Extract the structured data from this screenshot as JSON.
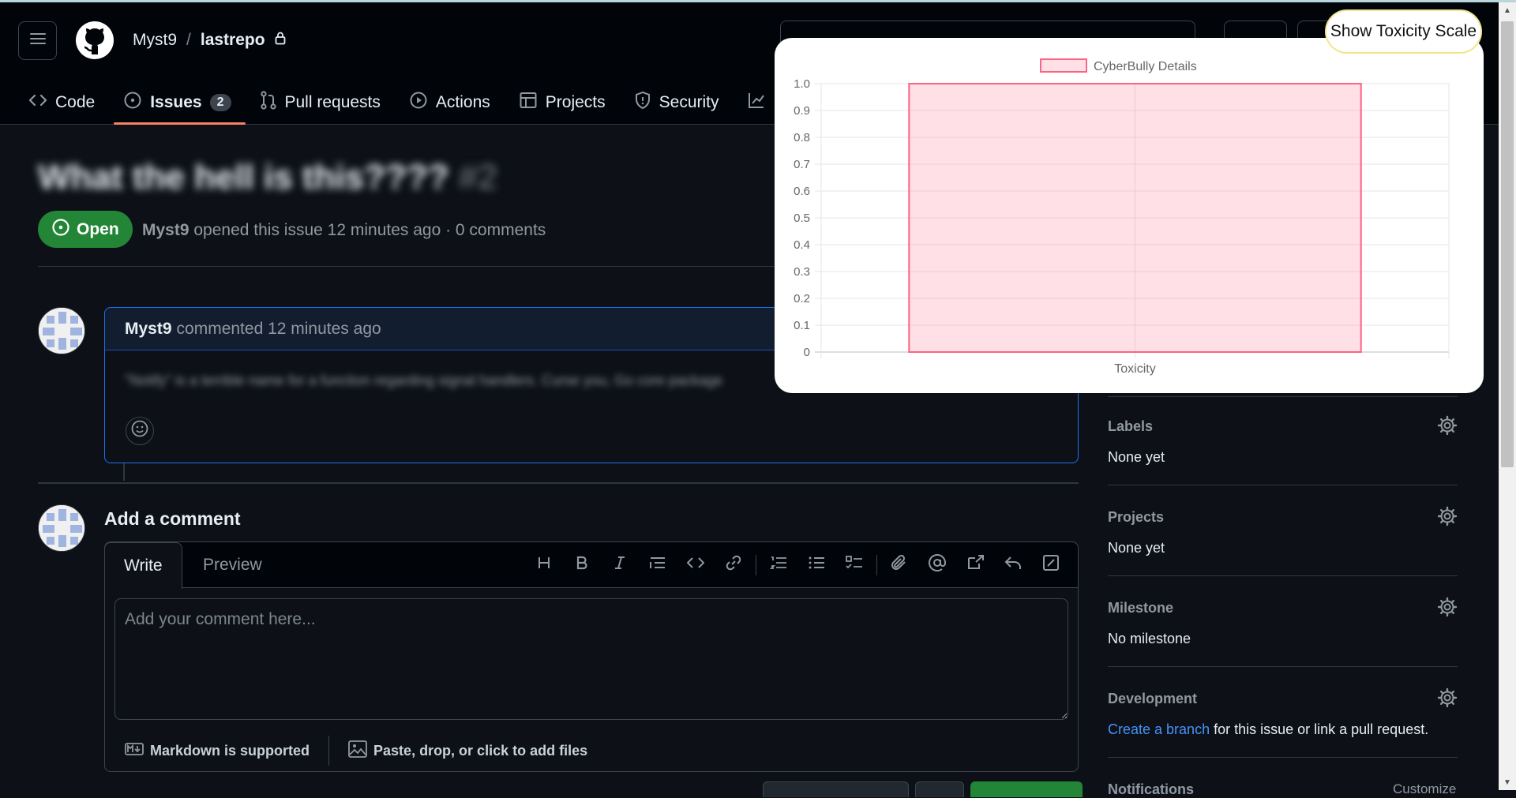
{
  "repo": {
    "owner": "Myst9",
    "separator": "/",
    "name": "lastrepo"
  },
  "nav": {
    "tabs": [
      {
        "label": "Code",
        "icon": "code-icon"
      },
      {
        "label": "Issues",
        "icon": "issue-opened-icon",
        "count": "2",
        "active": true
      },
      {
        "label": "Pull requests",
        "icon": "git-pull-request-icon"
      },
      {
        "label": "Actions",
        "icon": "play-icon"
      },
      {
        "label": "Projects",
        "icon": "table-icon"
      },
      {
        "label": "Security",
        "icon": "shield-icon"
      }
    ]
  },
  "issue": {
    "title": "What the hell is this????",
    "number": "#2",
    "state": "Open",
    "author": "Myst9",
    "meta": "opened this issue 12 minutes ago · 0 comments"
  },
  "comment": {
    "author": "Myst9",
    "meta": "commented 12 minutes ago",
    "body": "\"Notify\" is a terrible name for a function regarding signal handlers. Curse you, Go core package"
  },
  "add_comment": {
    "heading": "Add a comment",
    "tab_write": "Write",
    "tab_preview": "Preview",
    "placeholder": "Add your comment here...",
    "markdown_note": "Markdown is supported",
    "files_note": "Paste, drop, or click to add files"
  },
  "sidebar": {
    "labels": {
      "label": "Labels",
      "value": "None yet"
    },
    "projects": {
      "label": "Projects",
      "value": "None yet"
    },
    "milestone": {
      "label": "Milestone",
      "value": "No milestone"
    },
    "development": {
      "label": "Development",
      "link": "Create a branch",
      "rest": "for this issue or link a pull request."
    },
    "notifications": {
      "label": "Notifications",
      "action": "Customize"
    }
  },
  "extension": {
    "button_label": "Show Toxicity Scale"
  },
  "colors": {
    "accent_open": "#238636",
    "tab_underline": "#f78166",
    "link": "#4493f8",
    "bar_fill": "rgba(255, 99, 132, 0.2)",
    "bar_border": "rgb(255, 99, 132)"
  },
  "chart_data": {
    "type": "bar",
    "categories": [
      "Toxicity"
    ],
    "series": [
      {
        "name": "CyberBully Details",
        "values": [
          1.0
        ]
      }
    ],
    "ylim": [
      0,
      1.0
    ],
    "yticks": [
      "0",
      "0.1",
      "0.2",
      "0.3",
      "0.4",
      "0.5",
      "0.6",
      "0.7",
      "0.8",
      "0.9",
      "1.0"
    ],
    "legend": "top",
    "grid": true
  }
}
